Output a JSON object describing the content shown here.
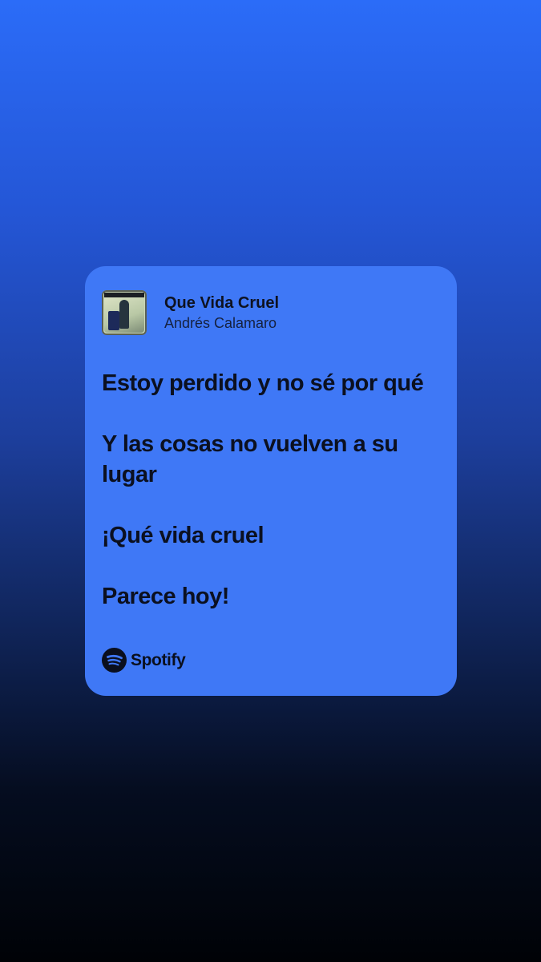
{
  "share_card": {
    "song_title": "Que Vida Cruel",
    "artist": "Andrés Calamaro",
    "lyrics": [
      "Estoy perdido y no sé por qué",
      "Y las cosas no vuelven a su lugar",
      "¡Qué vida cruel",
      "Parece hoy!"
    ],
    "brand": "Spotify",
    "card_color": "#3f78f6"
  },
  "icons": {
    "album_art": "album-cover-art",
    "brand_logo": "spotify-logo-icon"
  }
}
